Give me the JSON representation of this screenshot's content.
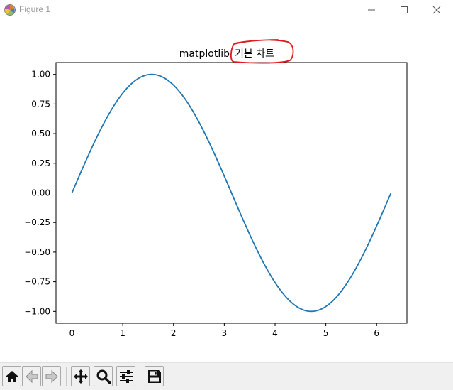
{
  "window": {
    "title": "Figure 1",
    "controls": [
      "minimize",
      "maximize",
      "close"
    ]
  },
  "chart_data": {
    "type": "line",
    "title_prefix": "matplotlib",
    "title_highlight": "기본 차트",
    "title": "matplotlib 기본 차트",
    "xlabel": "",
    "ylabel": "",
    "xlim": [
      -0.314,
      6.597
    ],
    "ylim": [
      -1.1,
      1.1
    ],
    "x_ticks": [
      0,
      1,
      2,
      3,
      4,
      5,
      6
    ],
    "x_tick_labels": [
      "0",
      "1",
      "2",
      "3",
      "4",
      "5",
      "6"
    ],
    "y_ticks": [
      1.0,
      0.75,
      0.5,
      0.25,
      0.0,
      -0.25,
      -0.5,
      -0.75,
      -1.0
    ],
    "y_tick_labels": [
      "1.00",
      "0.75",
      "0.50",
      "0.25",
      "0.00",
      "−0.25",
      "−0.50",
      "−0.75",
      "−1.00"
    ],
    "grid": false,
    "series": [
      {
        "color": "#1f77b4",
        "x": [
          0.0,
          0.25,
          0.5,
          0.75,
          1.0,
          1.25,
          1.5,
          1.5708,
          1.75,
          2.0,
          2.25,
          2.5,
          2.75,
          3.0,
          3.1416,
          3.25,
          3.5,
          3.75,
          4.0,
          4.25,
          4.5,
          4.7124,
          4.75,
          5.0,
          5.25,
          5.5,
          5.75,
          6.0,
          6.2832
        ],
        "y": [
          0.0,
          0.247,
          0.479,
          0.682,
          0.841,
          0.949,
          0.997,
          1.0,
          0.984,
          0.909,
          0.778,
          0.598,
          0.382,
          0.141,
          0.0,
          -0.108,
          -0.351,
          -0.572,
          -0.757,
          -0.895,
          -0.978,
          -1.0,
          -0.999,
          -0.959,
          -0.859,
          -0.706,
          -0.508,
          -0.279,
          0.0
        ]
      }
    ],
    "annotation": {
      "type": "hand-drawn ellipse",
      "color": "#e0191f",
      "target": "title_highlight"
    }
  },
  "toolbar": {
    "buttons": [
      {
        "name": "home",
        "icon": "home-icon"
      },
      {
        "name": "back",
        "icon": "back-arrow-icon"
      },
      {
        "name": "forward",
        "icon": "forward-arrow-icon"
      },
      {
        "name": "pan",
        "icon": "move-icon"
      },
      {
        "name": "zoom",
        "icon": "magnifier-icon"
      },
      {
        "name": "configure-subplots",
        "icon": "sliders-icon"
      },
      {
        "name": "save",
        "icon": "floppy-disk-icon"
      }
    ]
  }
}
